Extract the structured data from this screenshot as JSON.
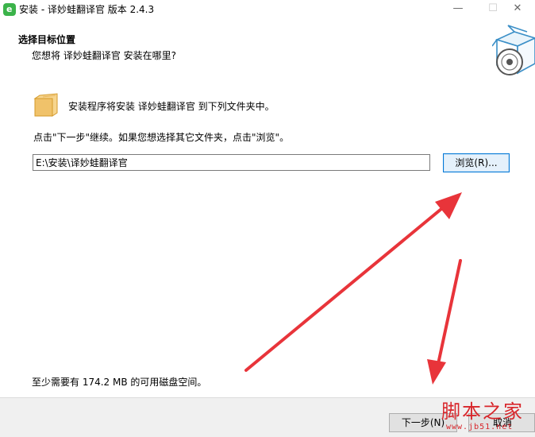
{
  "window": {
    "title": "安装 - 译妙蛙翻译官 版本 2.4.3",
    "app_icon_letter": "e",
    "minimize": "—",
    "maximize": "☐",
    "close": "✕"
  },
  "header": {
    "title": "选择目标位置",
    "subtitle": "您想将 译妙蛙翻译官 安装在哪里?"
  },
  "body": {
    "folder_text": "安装程序将安装 译妙蛙翻译官 到下列文件夹中。",
    "hint": "点击\"下一步\"继续。如果您想选择其它文件夹，点击\"浏览\"。",
    "install_path": "E:\\安装\\译妙蛙翻译官",
    "browse_label": "浏览(R)...",
    "disk_space": "至少需要有 174.2 MB 的可用磁盘空间。"
  },
  "footer": {
    "next_label": "下一步(N)",
    "cancel_label": "取消"
  },
  "watermark": {
    "text": "脚本之家",
    "url": "www.jb51.net"
  },
  "colors": {
    "arrow": "#e8343a",
    "accent": "#0078d7",
    "brand_green": "#3bb34a"
  }
}
